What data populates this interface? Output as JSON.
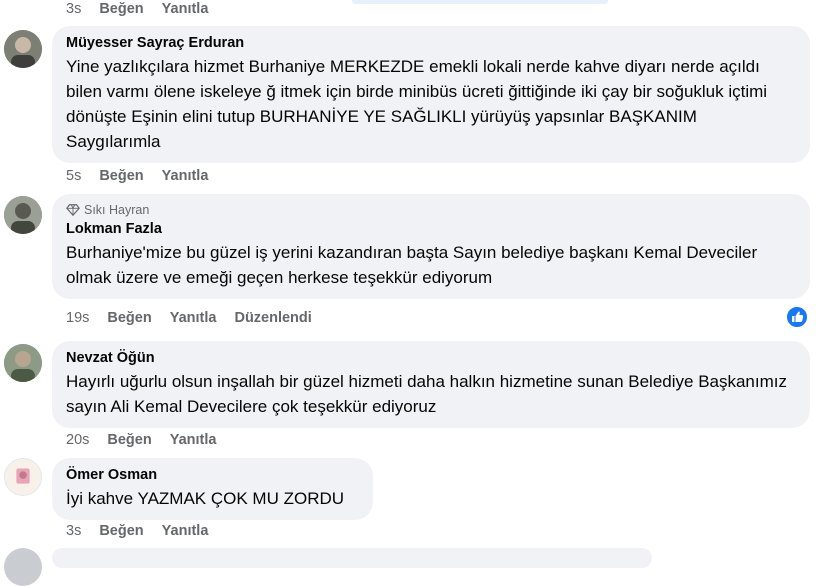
{
  "top_actions": {
    "time": "3s",
    "like": "Beğen",
    "reply": "Yanıtla"
  },
  "comments": [
    {
      "author": "Müyesser Sayraç Erduran",
      "text": "Yine yazlıkçılara hizmet Burhaniye MERKEZDE emekli lokali nerde kahve diyarı nerde açıldı bilen varmı ölene iskeleye ğ itmek için birde minibüs ücreti ğittiğinde iki çay bir soğukluk içtimi dönüşte Eşinin elini tutup BURHANİYE YE SAĞLIKLI yürüyüş yapsınlar BAŞKANIM Saygılarımla",
      "time": "5s",
      "like": "Beğen",
      "reply": "Yanıtla"
    },
    {
      "badge": "Sıkı Hayran",
      "author": "Lokman Fazla",
      "text": "Burhaniye'mize bu güzel iş yerini kazandıran başta Sayın belediye başkanı Kemal Deveciler olmak üzere ve emeği geçen herkese teşekkür ediyorum",
      "time": "19s",
      "like": "Beğen",
      "reply": "Yanıtla",
      "edited": "Düzenlendi"
    },
    {
      "author": "Nevzat Öğün",
      "text": "Hayırlı uğurlu olsun inşallah bir güzel hizmeti daha halkın hizmetine sunan Belediye Başkanımız sayın Ali Kemal Devecilere çok teşekkür ediyoruz",
      "time": "20s",
      "like": "Beğen",
      "reply": "Yanıtla"
    },
    {
      "author": "Ömer Osman",
      "text": "İyi kahve YAZMAK ÇOK MU ZORDU",
      "time": "3s",
      "like": "Beğen",
      "reply": "Yanıtla"
    }
  ],
  "colors": {
    "bubble": "#f0f2f5",
    "secondary_text": "#65676b",
    "like_blue": "#1877f2"
  },
  "icons": {
    "reaction": "like-icon",
    "badge": "diamond-icon"
  }
}
